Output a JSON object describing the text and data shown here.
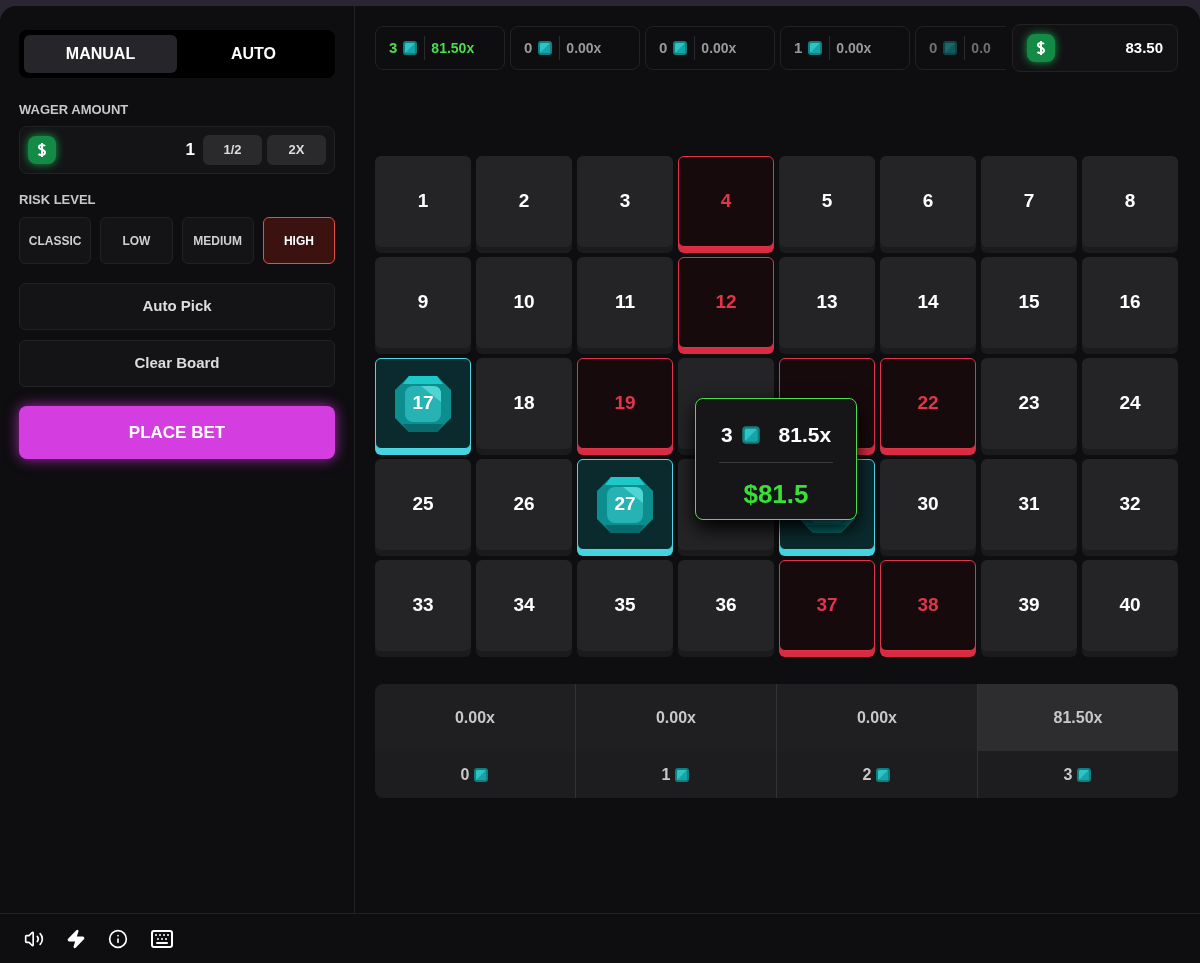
{
  "mode_tabs": [
    {
      "label": "MANUAL",
      "selected": true
    },
    {
      "label": "AUTO",
      "selected": false
    }
  ],
  "wager": {
    "label": "WAGER AMOUNT",
    "value": "1",
    "buttons": [
      "1/2",
      "2X"
    ]
  },
  "risk": {
    "label": "RISK LEVEL",
    "options": [
      {
        "label": "CLASSIC",
        "selected": false
      },
      {
        "label": "LOW",
        "selected": false
      },
      {
        "label": "MEDIUM",
        "selected": false
      },
      {
        "label": "HIGH",
        "selected": true
      }
    ]
  },
  "actions": [
    "Auto Pick",
    "Clear Board"
  ],
  "place_bet": "PLACE BET",
  "history": [
    {
      "gems": "3",
      "multiplier": "81.50x",
      "win": true,
      "faded": false
    },
    {
      "gems": "0",
      "multiplier": "0.00x",
      "win": false,
      "faded": false
    },
    {
      "gems": "0",
      "multiplier": "0.00x",
      "win": false,
      "faded": false
    },
    {
      "gems": "1",
      "multiplier": "0.00x",
      "win": false,
      "faded": false
    },
    {
      "gems": "0",
      "multiplier": "0.0",
      "win": false,
      "faded": true
    }
  ],
  "balance": "83.50",
  "tiles": [
    {
      "label": "1",
      "kind": "normal"
    },
    {
      "label": "2",
      "kind": "normal"
    },
    {
      "label": "3",
      "kind": "normal"
    },
    {
      "label": "4",
      "kind": "miss"
    },
    {
      "label": "5",
      "kind": "normal"
    },
    {
      "label": "6",
      "kind": "normal"
    },
    {
      "label": "7",
      "kind": "normal"
    },
    {
      "label": "8",
      "kind": "normal"
    },
    {
      "label": "9",
      "kind": "normal"
    },
    {
      "label": "10",
      "kind": "normal"
    },
    {
      "label": "11",
      "kind": "normal"
    },
    {
      "label": "12",
      "kind": "miss"
    },
    {
      "label": "13",
      "kind": "normal"
    },
    {
      "label": "14",
      "kind": "normal"
    },
    {
      "label": "15",
      "kind": "normal"
    },
    {
      "label": "16",
      "kind": "normal"
    },
    {
      "label": "17",
      "kind": "gem"
    },
    {
      "label": "18",
      "kind": "normal"
    },
    {
      "label": "19",
      "kind": "miss"
    },
    {
      "kind": "normal"
    },
    {
      "kind": "miss"
    },
    {
      "label": "22",
      "kind": "miss"
    },
    {
      "label": "23",
      "kind": "normal"
    },
    {
      "label": "24",
      "kind": "normal"
    },
    {
      "label": "25",
      "kind": "normal"
    },
    {
      "label": "26",
      "kind": "normal"
    },
    {
      "label": "27",
      "kind": "gem"
    },
    {
      "kind": "normal"
    },
    {
      "kind": "gem"
    },
    {
      "label": "30",
      "kind": "normal"
    },
    {
      "label": "31",
      "kind": "normal"
    },
    {
      "label": "32",
      "kind": "normal"
    },
    {
      "label": "33",
      "kind": "normal"
    },
    {
      "label": "34",
      "kind": "normal"
    },
    {
      "label": "35",
      "kind": "normal"
    },
    {
      "label": "36",
      "kind": "normal"
    },
    {
      "label": "37",
      "kind": "miss"
    },
    {
      "label": "38",
      "kind": "miss"
    },
    {
      "label": "39",
      "kind": "normal"
    },
    {
      "label": "40",
      "kind": "normal"
    }
  ],
  "tooltip": {
    "gems": "3",
    "multiplier": "81.5x",
    "payout": "$81.5"
  },
  "payouts": [
    {
      "multiplier": "0.00x",
      "gems": "0",
      "highlighted": false
    },
    {
      "multiplier": "0.00x",
      "gems": "1",
      "highlighted": false
    },
    {
      "multiplier": "0.00x",
      "gems": "2",
      "highlighted": false
    },
    {
      "multiplier": "81.50x",
      "gems": "3",
      "highlighted": true
    }
  ]
}
